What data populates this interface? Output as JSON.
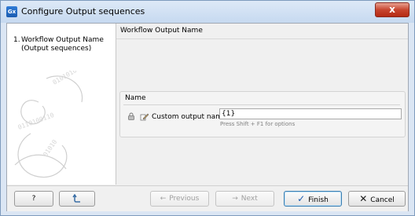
{
  "window": {
    "title": "Configure Output sequences",
    "app_icon_text": "Gx",
    "close_glyph": "x"
  },
  "steps": [
    {
      "number": "1.",
      "line1": "Workflow Output Name",
      "line2": "(Output sequences)"
    }
  ],
  "page": {
    "header": "Workflow Output Name",
    "group_title": "Name",
    "field_label": "Custom output name",
    "field_value": "{1}",
    "hint": "Press Shift + F1 for options"
  },
  "footer": {
    "help_label": "?",
    "previous_label": "Previous",
    "next_label": "Next",
    "finish_label": "Finish",
    "cancel_label": "Cancel"
  },
  "icons": [
    "lock-icon",
    "edit-pencil-icon",
    "reset-icon",
    "arrow-left-icon",
    "arrow-right-icon",
    "check-icon",
    "cancel-x-icon"
  ],
  "colors": {
    "accent": "#1b5cb0",
    "close_red": "#c7452f",
    "title_bg": "#c6d9f0"
  }
}
